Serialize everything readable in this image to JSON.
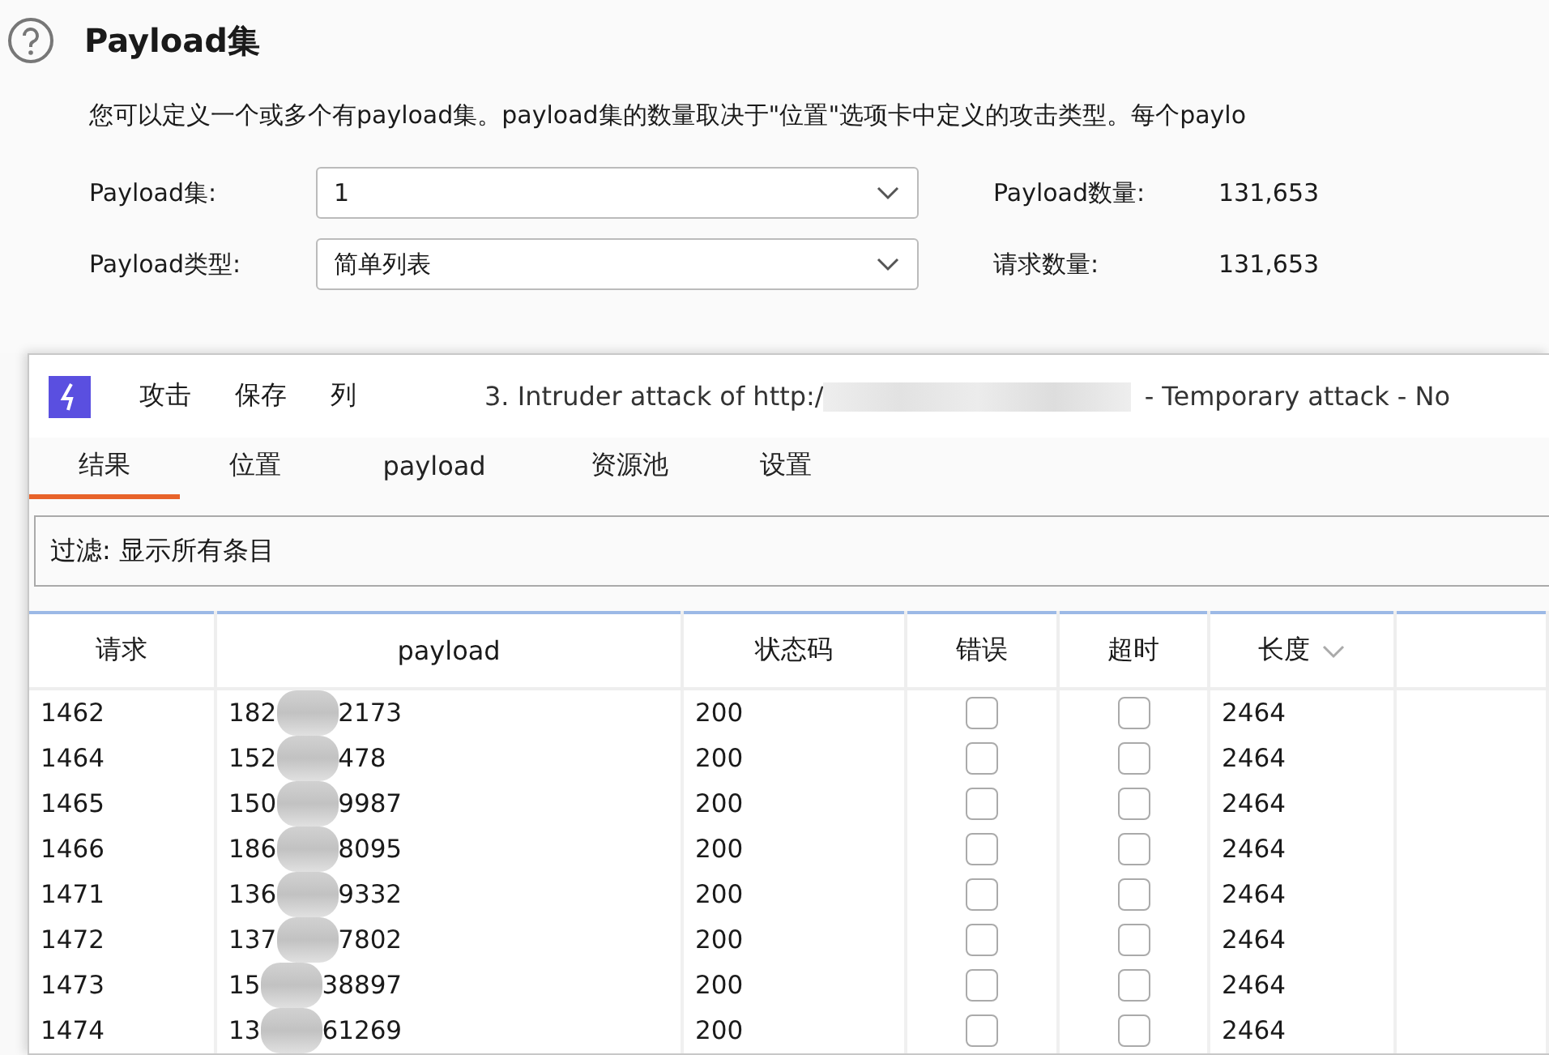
{
  "payload_sets": {
    "title": "Payload集",
    "description": "您可以定义一个或多个有payload集。payload集的数量取决于\"位置\"选项卡中定义的攻击类型。每个paylo",
    "fields": [
      {
        "label": "Payload集:",
        "value": "1",
        "count_label": "Payload数量:",
        "count": "131,653"
      },
      {
        "label": "Payload类型:",
        "value": "简单列表",
        "count_label": "请求数量:",
        "count": "131,653"
      }
    ]
  },
  "attack_window": {
    "menu": [
      "攻击",
      "保存",
      "列"
    ],
    "title_start": "3. Intruder attack of http:/",
    "title_end": "- Temporary attack - No",
    "tabs": [
      {
        "label": "结果",
        "selected": true
      },
      {
        "label": "位置",
        "selected": false
      },
      {
        "label": "payload",
        "selected": false
      },
      {
        "label": "资源池",
        "selected": false
      },
      {
        "label": "设置",
        "selected": false
      }
    ],
    "filter": "过滤: 显示所有条目",
    "table": {
      "columns": [
        "请求",
        "payload",
        "状态码",
        "错误",
        "超时",
        "长度"
      ],
      "rows": [
        {
          "request": "1462",
          "payload_start": "182",
          "payload_end": "2173",
          "status": "200",
          "error": false,
          "timeout": false,
          "length": "2464"
        },
        {
          "request": "1464",
          "payload_start": "152",
          "payload_end": "478",
          "status": "200",
          "error": false,
          "timeout": false,
          "length": "2464"
        },
        {
          "request": "1465",
          "payload_start": "150",
          "payload_end": "9987",
          "status": "200",
          "error": false,
          "timeout": false,
          "length": "2464"
        },
        {
          "request": "1466",
          "payload_start": "186",
          "payload_end": "8095",
          "status": "200",
          "error": false,
          "timeout": false,
          "length": "2464"
        },
        {
          "request": "1471",
          "payload_start": "136",
          "payload_end": "9332",
          "status": "200",
          "error": false,
          "timeout": false,
          "length": "2464"
        },
        {
          "request": "1472",
          "payload_start": "137",
          "payload_end": "7802",
          "status": "200",
          "error": false,
          "timeout": false,
          "length": "2464"
        },
        {
          "request": "1473",
          "payload_start": "15",
          "payload_end": "38897",
          "status": "200",
          "error": false,
          "timeout": false,
          "length": "2464"
        },
        {
          "request": "1474",
          "payload_start": "13",
          "payload_end": "61269",
          "status": "200",
          "error": false,
          "timeout": false,
          "length": "2464"
        }
      ]
    }
  }
}
